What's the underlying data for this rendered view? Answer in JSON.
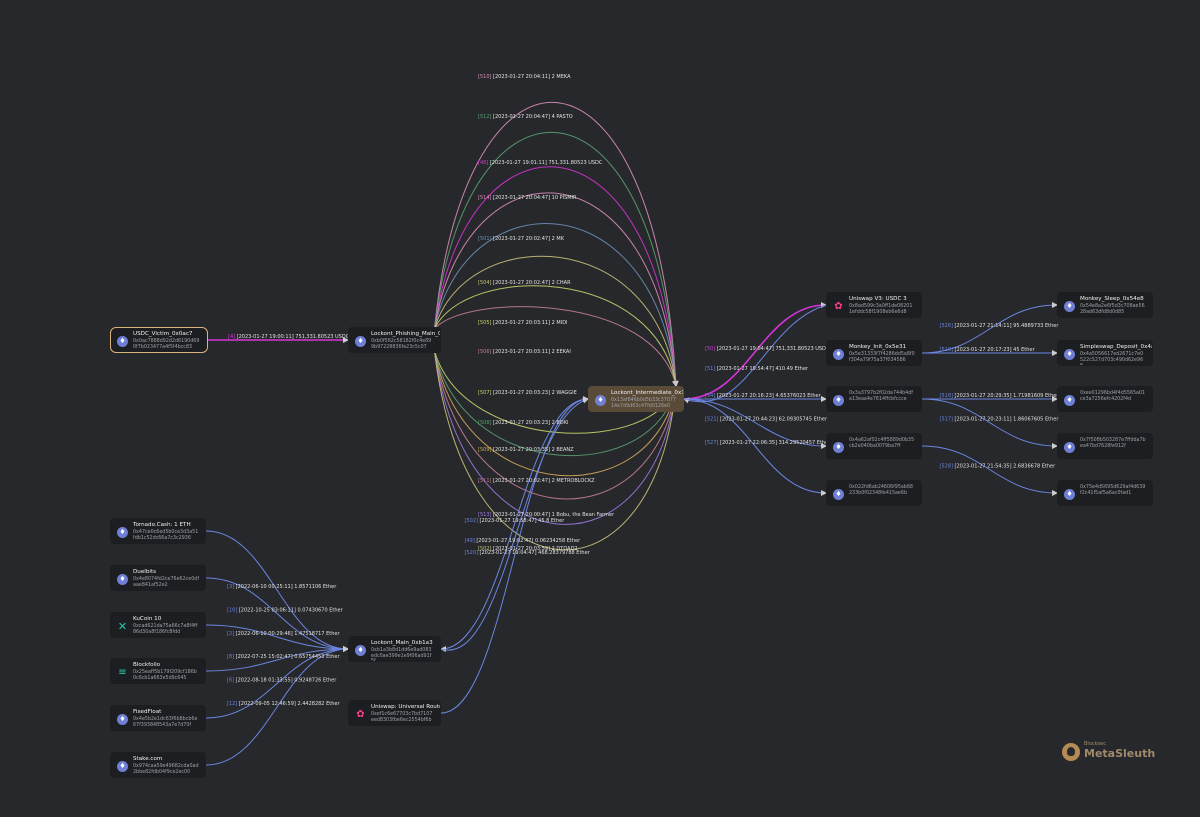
{
  "brand": {
    "small": "Blocksec",
    "name": "MetaSleuth"
  },
  "colors": {
    "blue": "#6b86e0",
    "magenta": "#d535d8",
    "pink": "#d98fb8",
    "green": "#58a072",
    "lavender": "#9b7ae0",
    "steel": "#6e8fb4",
    "khaki": "#c9c27c",
    "lime": "#c8d66d",
    "rose": "#c47e94",
    "gold": "#d4aa5c"
  },
  "nodes": {
    "victim": {
      "title": "USDC_Victim_0x0ac7",
      "addr": "0x0ac7888d92d2d6190d690f7b023477a4f5f4bcc83",
      "icon": "ethereum-icon"
    },
    "phishing": {
      "title": "Lockont_Phishing_Main_0xb0f5",
      "addr": "0xb0f562c58182f0c4e899b97228836fe23c5c07",
      "icon": "ethereum-icon"
    },
    "intermediate": {
      "title": "Lockont_Intermediate_0x13af",
      "addr": "0x13af846b0d5b33c3707714e7d9d63c47fd0126e0",
      "icon": "ethereum-icon"
    },
    "uniswap_v3": {
      "title": "Uniswap V3: USDC 3",
      "addr": "0x8ad599c3a0ff1de082011efddc58f1908eb6e6d8",
      "icon": "uniswap-icon"
    },
    "monkey_sleep": {
      "title": "Monkey_Sleep_0x54e8",
      "addr": "0x54e8a2e6f5d3c708ae5628ad63dfd8d0d85",
      "icon": "ethereum-icon"
    },
    "monkey_init": {
      "title": "Monkey_Init_0x5e31",
      "addr": "0x5e31333f7f4286dd5a8f0f304a79f75a37f034586",
      "icon": "ethereum-icon"
    },
    "simpleswap": {
      "title": "Simpleswap_Deposit_0x4a50",
      "addr": "0x4a5056617ed2671c7e0522c527d703c490d62e96e",
      "icon": "ethereum-icon"
    },
    "addr_3a3": {
      "title": "",
      "addr": "0x3a3797b2f02da744b4dfa13eaa4e7614ffcbfccce",
      "icon": "ethereum-icon"
    },
    "addr_0ee": {
      "title": "",
      "addr": "0xee01296bd4f4d5565a01ce3a7256efc4202f4d",
      "icon": "ethereum-icon"
    },
    "addr_7f5": {
      "title": "",
      "addr": "0x7f508b503287e7ffdda7bea47bd7628fe912f",
      "icon": "ethereum-icon"
    },
    "addr_4a6": {
      "title": "",
      "addr": "0x4a62af02c4ff5889d0b35cb2e040ba0079ba7ff",
      "icon": "ethereum-icon"
    },
    "addr_75e": {
      "title": "",
      "addr": "0x75e4d5695d629af4d639f2c41f5af5a6ac0fad1",
      "icon": "ethereum-icon"
    },
    "addr_022": {
      "title": "",
      "addr": "0x022fd6ab24606f95ab68233b0f02348fe415ae6b",
      "icon": "ethereum-icon"
    },
    "main": {
      "title": "Lockont_Main_0xb1a3",
      "addr": "0xb1a3b8d1dd6e9ad083edc0ae399e1e9f06ad91f5f",
      "icon": "ethereum-icon"
    },
    "tornado": {
      "title": "Tornado.Cash: 1 ETH",
      "addr": "0x47ce0c6ed5b0ce3d3a51fdb1c52dc66a7c3c2936",
      "icon": "ethereum-icon"
    },
    "duelbits": {
      "title": "Duelbits",
      "addr": "0x4e8074fd2ce76e62ce0dfaae841af52e2",
      "icon": "ethereum-icon"
    },
    "kucoin": {
      "title": "KuCoin 10",
      "addr": "0xcad621da75a66c7a8f4ff86d30a8f186fc8fdd",
      "icon": "kucoin-icon"
    },
    "blockfolio": {
      "title": "Blockfolio",
      "addr": "0x25eaff5b179f209cf186b0c6cb1a663e5d9c645",
      "icon": "blockfolio-icon"
    },
    "fixedfloat": {
      "title": "FixedFloat",
      "addr": "0x4e5b2e1dc63f6b8bcb6e67f393848543a7e7d70f",
      "icon": "ethereum-icon"
    },
    "stake": {
      "title": "Stake.com",
      "addr": "0x974caa59e49682cda0ad2bbe82fdb04f9ce2ec00",
      "icon": "ethereum-icon"
    },
    "universal_router": {
      "title": "Uniswap: Universal Router",
      "addr": "0xef1c6e67703c7bd7107eed8303fbe6ec2554bf6b",
      "icon": "uniswap-icon"
    }
  },
  "edges": [
    {
      "from": "victim",
      "to": "phishing",
      "color": "#d535d8",
      "idx": "[4]",
      "label": "[2023-01-27 19:00:11] 751,331.80523 USDC"
    },
    {
      "from": "phishing",
      "to": "intermediate",
      "color": "#d98fb8",
      "idx": "[510]",
      "label": "[2023-01-27 20:04:11] 2 MEKA",
      "arch": "arc1"
    },
    {
      "from": "phishing",
      "to": "intermediate",
      "color": "#58a072",
      "idx": "[512]",
      "label": "[2023-01-27 20:04:47] 4 PASTO",
      "arch": "arc2"
    },
    {
      "from": "phishing",
      "to": "intermediate",
      "color": "#d535d8",
      "idx": "[48]",
      "label": "[2023-01-27 19:01:11] 751,331.80523 USDC",
      "arch": "arc3"
    },
    {
      "from": "phishing",
      "to": "intermediate",
      "color": "#d98fb8",
      "idx": "[514]",
      "label": "[2023-01-27 20:04:47] 10 PISMIR",
      "arch": "arc4"
    },
    {
      "from": "phishing",
      "to": "intermediate",
      "color": "#6e8fb4",
      "idx": "[501]",
      "label": "[2023-01-27 20:02:47] 2 MK",
      "arch": "arc5"
    },
    {
      "from": "phishing",
      "to": "intermediate",
      "color": "#c9c27c",
      "idx": "[504]",
      "label": "[2023-01-27 20:02:47] 2 CHAR",
      "arch": "arc6"
    },
    {
      "from": "phishing",
      "to": "intermediate",
      "color": "#c8d66d",
      "idx": "[505]",
      "label": "[2023-01-27 20:03:11] 2 MIDI",
      "arch": "arc7"
    },
    {
      "from": "phishing",
      "to": "intermediate",
      "color": "#c47e94",
      "idx": "[506]",
      "label": "[2023-01-27 20:03:11] 2 EEKAI",
      "arch": "arc8"
    },
    {
      "from": "phishing",
      "to": "intermediate",
      "color": "#c8d66d",
      "idx": "[507]",
      "label": "[2023-01-27 20:03:23] 2 WAGGIE",
      "arch": "arc9"
    },
    {
      "from": "phishing",
      "to": "intermediate",
      "color": "#58a072",
      "idx": "[508]",
      "label": "[2023-01-27 20:03:23] 2 BOKI",
      "arch": "arc10"
    },
    {
      "from": "phishing",
      "to": "intermediate",
      "color": "#d4aa5c",
      "idx": "[509]",
      "label": "[2023-01-27 20:03:35] 2 BEANZ",
      "arch": "arc11"
    },
    {
      "from": "phishing",
      "to": "intermediate",
      "color": "#c47e94",
      "idx": "[511]",
      "label": "[2023-01-27 20:02:47] 2 METROBLOCKZ",
      "arch": "arc12"
    },
    {
      "from": "phishing",
      "to": "intermediate",
      "color": "#9b7ae0",
      "idx": "[513]",
      "label": "[2023-01-27 20:00:47] 1 Bobu, the Bean Farmer",
      "arch": "arc13"
    },
    {
      "from": "phishing",
      "to": "intermediate",
      "color": "#c9c27c",
      "idx": "[502]",
      "label": "[2023-01-27 20:03:59] 2 DTOAD2",
      "arch": "arc14"
    },
    {
      "from": "intermediate",
      "to": "uniswap_v3",
      "color": "#d535d8",
      "idx": "[50]",
      "label": "[2023-01-27 19:04:47] 751,331.80523 USDC"
    },
    {
      "from": "uniswap_v3",
      "to": "intermediate",
      "color": "#6b86e0",
      "idx": "[51]",
      "label": "[2023-01-27 19:54:47] 410.49 Ether"
    },
    {
      "from": "intermediate",
      "to": "addr_3a3",
      "color": "#6b86e0",
      "idx": "[54]",
      "label": "[2023-01-27 20:16:23] 4.65376023 Ether"
    },
    {
      "from": "intermediate",
      "to": "addr_4a6",
      "color": "#6b86e0",
      "idx": "[521]",
      "label": "[2023-01-27 20:44:23] 62.09305745 Ether"
    },
    {
      "from": "intermediate",
      "to": "addr_022",
      "color": "#6b86e0",
      "idx": "[527]",
      "label": "[2023-01-27 22:06:35] 314.29520457 Ether"
    },
    {
      "from": "monkey_init",
      "to": "monkey_sleep",
      "color": "#6b86e0",
      "idx": "[526]",
      "label": "[2023-01-27 21:14:11] 95.4889733 Ether"
    },
    {
      "from": "monkey_init",
      "to": "simpleswap",
      "color": "#6b86e0",
      "idx": "[519]",
      "label": "[2023-01-27 20:17:23] 45 Ether"
    },
    {
      "from": "addr_3a3",
      "to": "addr_0ee",
      "color": "#6b86e0",
      "idx": "[518]",
      "label": "[2023-01-27 20:29:35] 1.71981609 Ether"
    },
    {
      "from": "addr_3a3",
      "to": "addr_7f5",
      "color": "#6b86e0",
      "idx": "[517]",
      "label": "[2023-01-27 20:23:11] 1.86067605 Ether"
    },
    {
      "from": "addr_4a6",
      "to": "addr_75e",
      "color": "#6b86e0",
      "idx": "[528]",
      "label": "[2023-01-27 21:54:35] 2.6836678 Ether"
    },
    {
      "from": "intermediate",
      "to": "main",
      "color": "#6b86e0",
      "idx": "[502]",
      "label": "[2023-01-27 19:58:47] 45.8 Ether"
    },
    {
      "from": "main",
      "to": "intermediate",
      "color": "#6b86e0",
      "idx": "[49]",
      "label": "[2023-01-27 19:02:47] 0.06234258 Ether"
    },
    {
      "from": "universal_router",
      "to": "intermediate",
      "color": "#6b86e0",
      "idx": "[520]",
      "label": "[2023-01-27 19:04:47] 468.28379788 Ether"
    },
    {
      "from": "tornado",
      "to": "main",
      "color": "#6b86e0",
      "idx": "[3]",
      "label": "[2022-06-10 00:25:11] 1.8571106 Ether"
    },
    {
      "from": "duelbits",
      "to": "main",
      "color": "#6b86e0",
      "idx": "[10]",
      "label": "[2022-10-25 03:06:11] 0.07430670 Ether"
    },
    {
      "from": "kucoin",
      "to": "main",
      "color": "#6b86e0",
      "idx": "[2]",
      "label": "[2022-06-10 00:29:46] 1.47518717 Ether"
    },
    {
      "from": "blockfolio",
      "to": "main",
      "color": "#6b86e0",
      "idx": "[8]",
      "label": "[2022-07-25 15:02:47] 0.65754453 Ether"
    },
    {
      "from": "fixedfloat",
      "to": "main",
      "color": "#6b86e0",
      "idx": "[6]",
      "label": "[2022-08-18 01:33:55] 0.9248726 Ether"
    },
    {
      "from": "stake",
      "to": "main",
      "color": "#6b86e0",
      "idx": "[12]",
      "label": "[2022-09-05 12:46:59] 2.4428282 Ether"
    }
  ]
}
